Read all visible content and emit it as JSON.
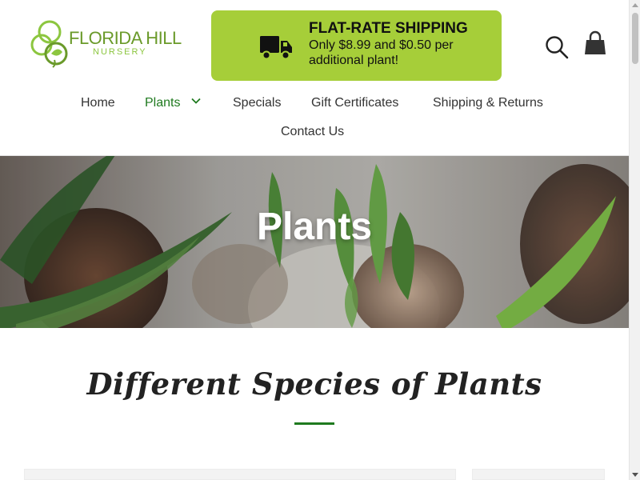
{
  "logo": {
    "name": "FLORIDA HILL",
    "sub": "NURSERY",
    "brand_color": "#6a9a2a"
  },
  "shipping_banner": {
    "title": "FLAT-RATE SHIPPING",
    "subtitle": "Only $8.99 and $0.50 per additional plant!",
    "icon": "truck-icon",
    "background": "#a6ce39"
  },
  "header_icons": {
    "search": "search-icon",
    "cart": "shopping-bag-icon"
  },
  "nav": {
    "items": [
      {
        "label": "Home"
      },
      {
        "label": "Plants",
        "active": true,
        "has_dropdown": true
      },
      {
        "label": "Specials"
      },
      {
        "label": "Gift Certificates"
      },
      {
        "label": "Shipping & Returns"
      },
      {
        "label": "Contact Us"
      }
    ],
    "active_color": "#1f7a1f"
  },
  "hero": {
    "title": "Plants"
  },
  "section": {
    "title": "Different Species of Plants",
    "accent_color": "#1f7a1f"
  }
}
